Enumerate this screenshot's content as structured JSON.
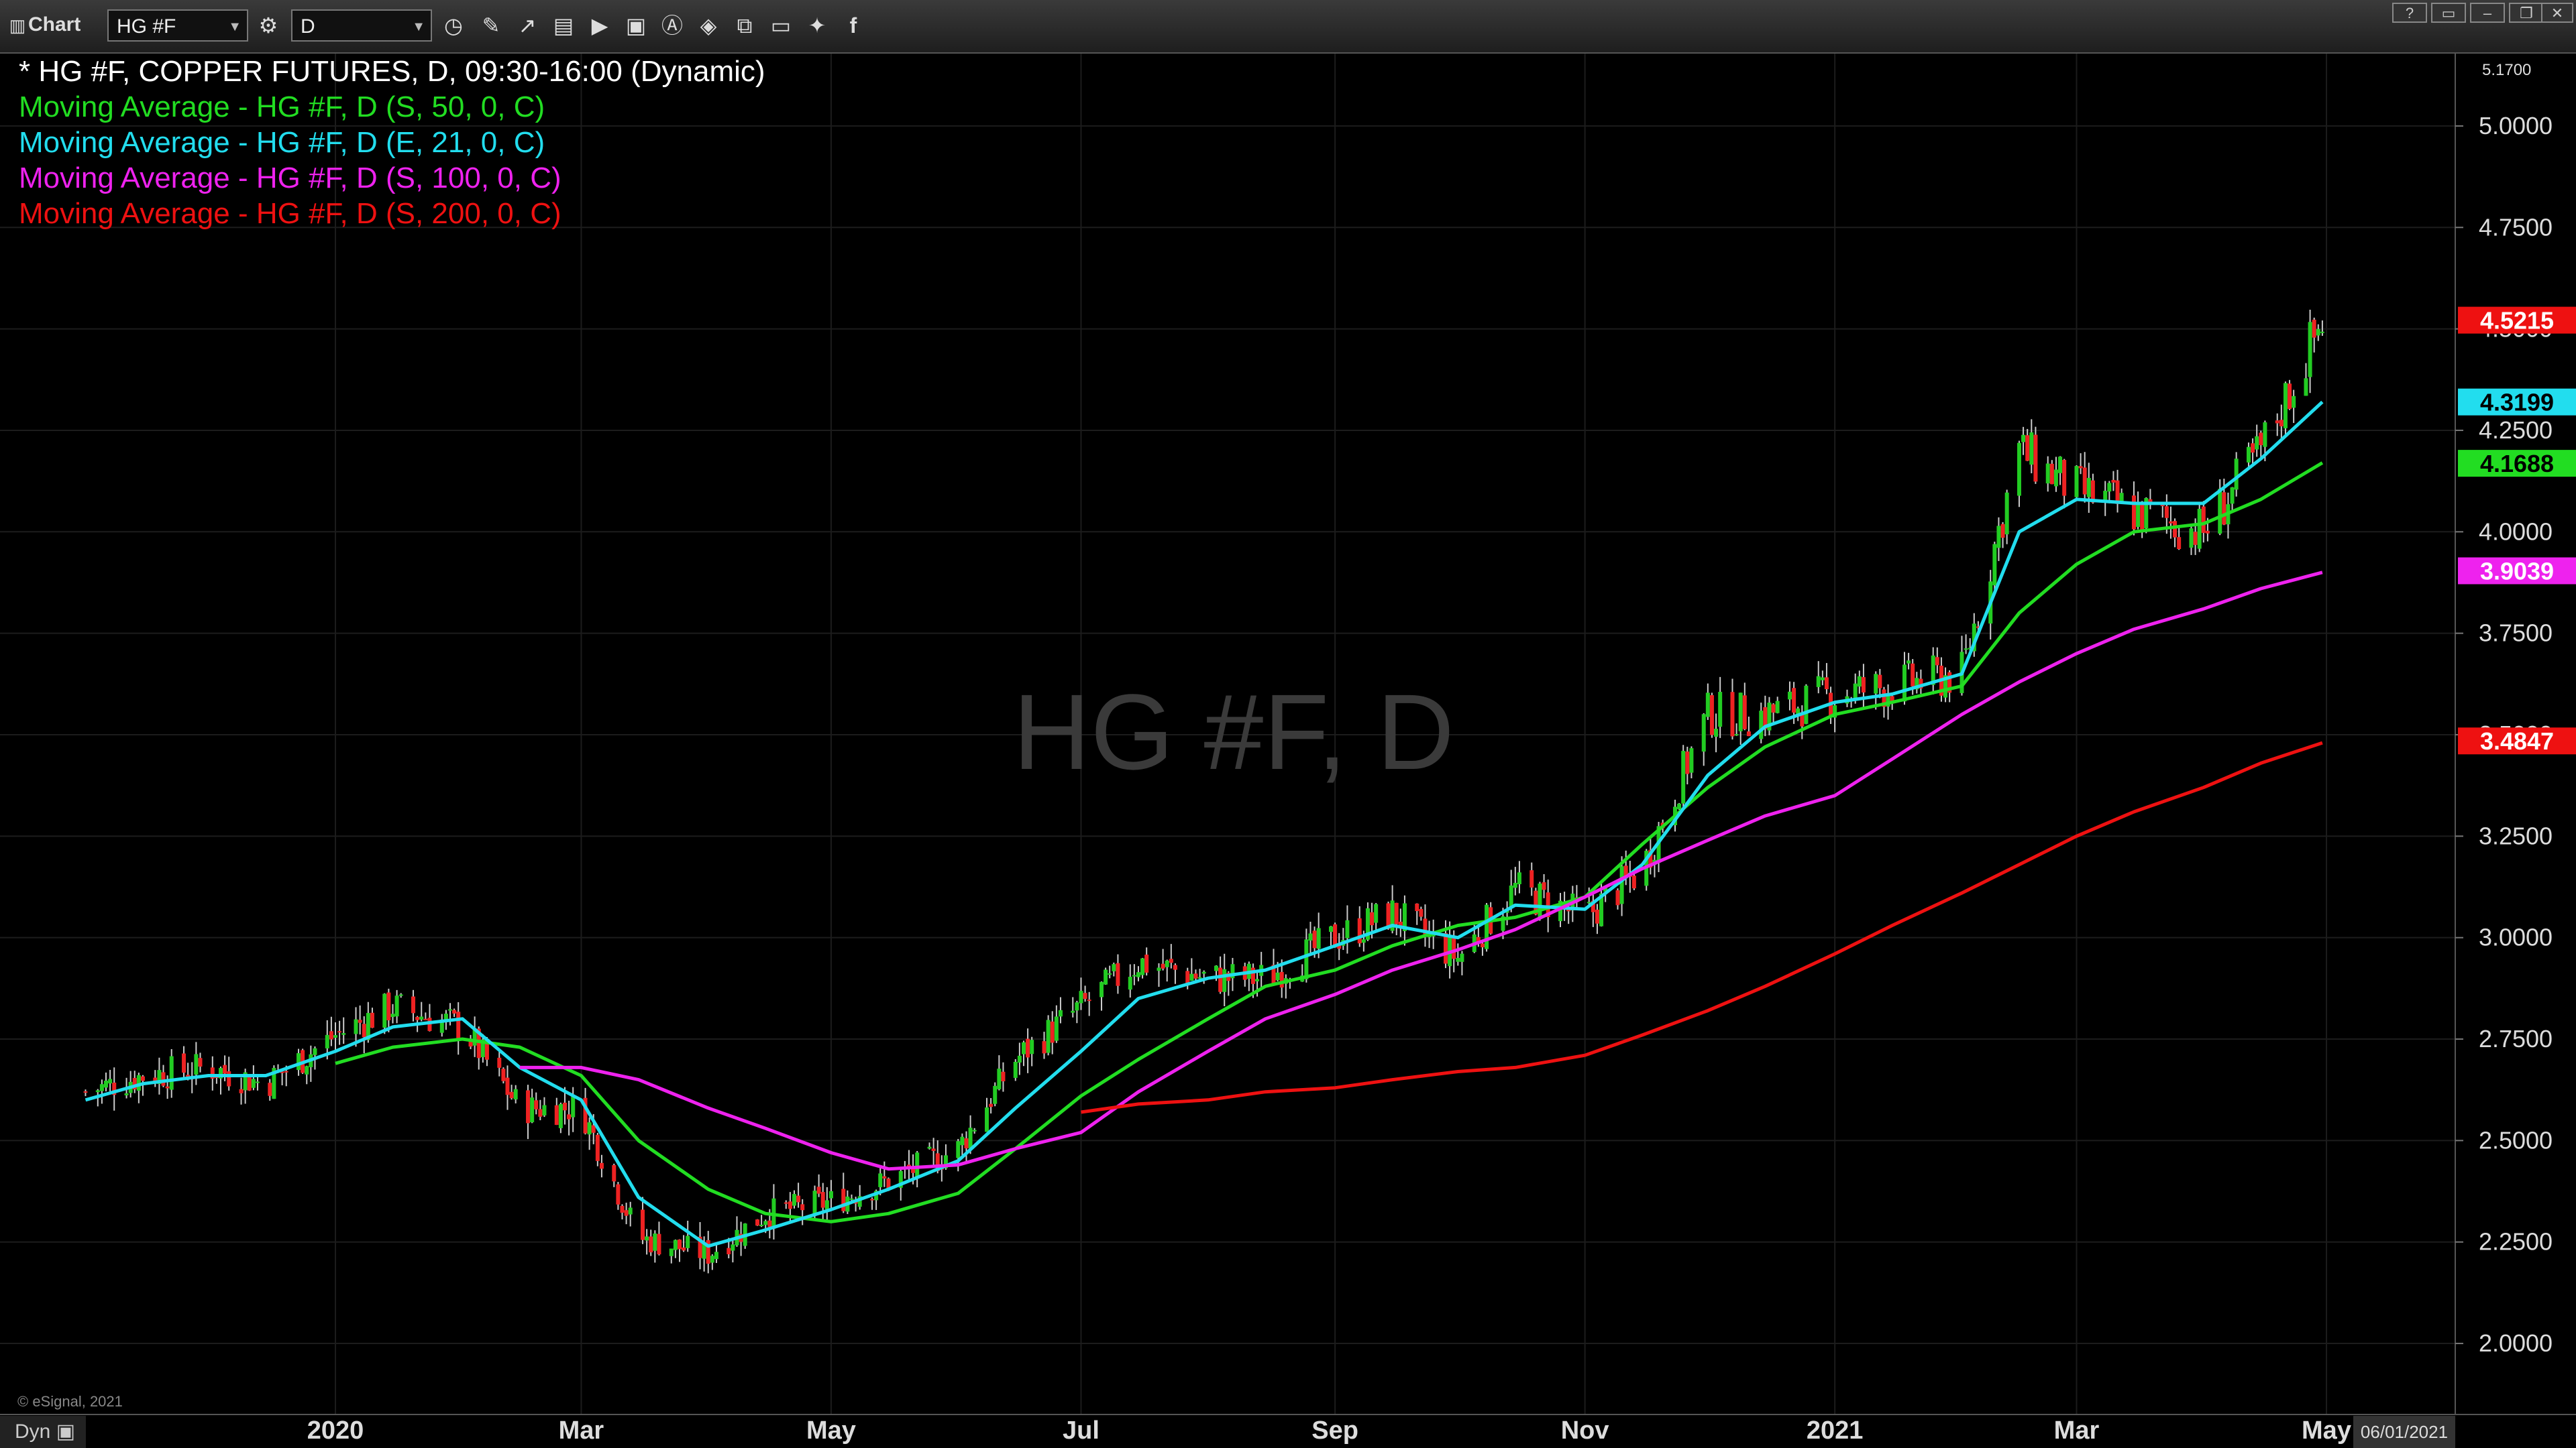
{
  "toolbar": {
    "chart_label": "Chart",
    "symbol_value": "HG #F",
    "interval_value": "D"
  },
  "legend": [
    {
      "text": "* HG #F, COPPER FUTURES, D, 09:30-16:00 (Dynamic)",
      "color": "#ffffff"
    },
    {
      "text": "Moving Average - HG #F, D (S, 50, 0, C)",
      "color": "#22dd22"
    },
    {
      "text": "Moving Average - HG #F, D (E, 21, 0, C)",
      "color": "#22ddee"
    },
    {
      "text": "Moving Average - HG #F, D (S, 100, 0, C)",
      "color": "#ee22ee"
    },
    {
      "text": "Moving Average - HG #F, D (S, 200, 0, C)",
      "color": "#ee1111"
    }
  ],
  "watermark": "HG #F, D",
  "copyright": "© eSignal, 2021",
  "footer": {
    "dyn_label": "Dyn",
    "date_box": "06/01/2021"
  },
  "axis_top_value": "5.1700",
  "chart_data": {
    "type": "line",
    "title": "* HG #F, COPPER FUTURES, D, 09:30-16:00 (Dynamic)",
    "xlabel": "",
    "ylabel": "",
    "ylim": [
      1.825,
      5.17
    ],
    "y_ticks": [
      "2.0000",
      "2.2500",
      "2.5000",
      "2.7500",
      "3.0000",
      "3.2500",
      "3.5000",
      "3.7500",
      "4.0000",
      "4.2500",
      "4.5000",
      "4.7500",
      "5.0000"
    ],
    "x_ticks": [
      "2020",
      "Mar",
      "May",
      "Jul",
      "Sep",
      "Nov",
      "2021",
      "Mar",
      "May"
    ],
    "grid": true,
    "x": [
      "2019-11-01",
      "2019-11-15",
      "2019-12-01",
      "2019-12-15",
      "2020-01-01",
      "2020-01-15",
      "2020-02-01",
      "2020-02-15",
      "2020-03-01",
      "2020-03-15",
      "2020-04-01",
      "2020-04-15",
      "2020-05-01",
      "2020-05-15",
      "2020-06-01",
      "2020-06-15",
      "2020-07-01",
      "2020-07-15",
      "2020-08-01",
      "2020-08-15",
      "2020-09-01",
      "2020-09-15",
      "2020-10-01",
      "2020-10-15",
      "2020-11-01",
      "2020-11-15",
      "2020-12-01",
      "2020-12-15",
      "2021-01-01",
      "2021-01-15",
      "2021-02-01",
      "2021-02-15",
      "2021-03-01",
      "2021-03-15",
      "2021-04-01",
      "2021-04-15",
      "2021-04-30"
    ],
    "series": [
      {
        "name": "HG #F, COPPER FUTURES",
        "color": "#ffffff",
        "values": [
          2.62,
          2.66,
          2.68,
          2.64,
          2.76,
          2.83,
          2.78,
          2.58,
          2.58,
          2.26,
          2.22,
          2.32,
          2.35,
          2.4,
          2.48,
          2.7,
          2.83,
          2.94,
          2.9,
          2.9,
          3.0,
          3.06,
          2.95,
          3.12,
          3.05,
          3.17,
          3.55,
          3.55,
          3.6,
          3.62,
          3.65,
          4.2,
          4.1,
          4.05,
          4.0,
          4.2,
          4.52
        ]
      },
      {
        "name": "Moving Average - HG #F, D (S, 50, 0, C)",
        "color": "#22dd22",
        "values": [
          null,
          null,
          null,
          null,
          2.69,
          2.73,
          2.75,
          2.73,
          2.66,
          2.5,
          2.38,
          2.32,
          2.3,
          2.32,
          2.37,
          2.48,
          2.61,
          2.7,
          2.8,
          2.88,
          2.92,
          2.98,
          3.03,
          3.05,
          3.1,
          3.23,
          3.37,
          3.47,
          3.55,
          3.58,
          3.62,
          3.8,
          3.92,
          4.0,
          4.02,
          4.08,
          4.17
        ]
      },
      {
        "name": "Moving Average - HG #F, D (E, 21, 0, C)",
        "color": "#22ddee",
        "values": [
          2.6,
          2.64,
          2.66,
          2.66,
          2.72,
          2.78,
          2.8,
          2.68,
          2.6,
          2.36,
          2.24,
          2.28,
          2.33,
          2.38,
          2.45,
          2.58,
          2.72,
          2.85,
          2.9,
          2.92,
          2.98,
          3.03,
          3.0,
          3.08,
          3.07,
          3.18,
          3.4,
          3.52,
          3.58,
          3.6,
          3.65,
          4.0,
          4.08,
          4.07,
          4.07,
          4.18,
          4.32
        ]
      },
      {
        "name": "Moving Average - HG #F, D (S, 100, 0, C)",
        "color": "#ee22ee",
        "values": [
          null,
          null,
          null,
          null,
          null,
          null,
          null,
          2.68,
          2.68,
          2.65,
          2.58,
          2.53,
          2.47,
          2.43,
          2.44,
          2.48,
          2.52,
          2.62,
          2.72,
          2.8,
          2.86,
          2.92,
          2.97,
          3.02,
          3.1,
          3.17,
          3.24,
          3.3,
          3.35,
          3.44,
          3.55,
          3.63,
          3.7,
          3.76,
          3.81,
          3.86,
          3.9
        ]
      },
      {
        "name": "Moving Average - HG #F, D (S, 200, 0, C)",
        "color": "#ee1111",
        "values": [
          null,
          null,
          null,
          null,
          null,
          null,
          null,
          null,
          null,
          null,
          null,
          null,
          null,
          null,
          null,
          null,
          2.57,
          2.59,
          2.6,
          2.62,
          2.63,
          2.65,
          2.67,
          2.68,
          2.71,
          2.76,
          2.82,
          2.88,
          2.96,
          3.03,
          3.11,
          3.18,
          3.25,
          3.31,
          3.37,
          3.43,
          3.48
        ]
      }
    ],
    "last_values": [
      {
        "label": "4.5215",
        "value": 4.5215,
        "bg": "#ee1111",
        "fg": "#ffffff"
      },
      {
        "label": "4.3199",
        "value": 4.3199,
        "bg": "#22ddee",
        "fg": "#000000"
      },
      {
        "label": "4.1688",
        "value": 4.1688,
        "bg": "#22dd22",
        "fg": "#000000"
      },
      {
        "label": "3.9039",
        "value": 3.9039,
        "bg": "#ee22ee",
        "fg": "#ffffff"
      },
      {
        "label": "3.4847",
        "value": 3.4847,
        "bg": "#ee1111",
        "fg": "#ffffff"
      }
    ]
  }
}
